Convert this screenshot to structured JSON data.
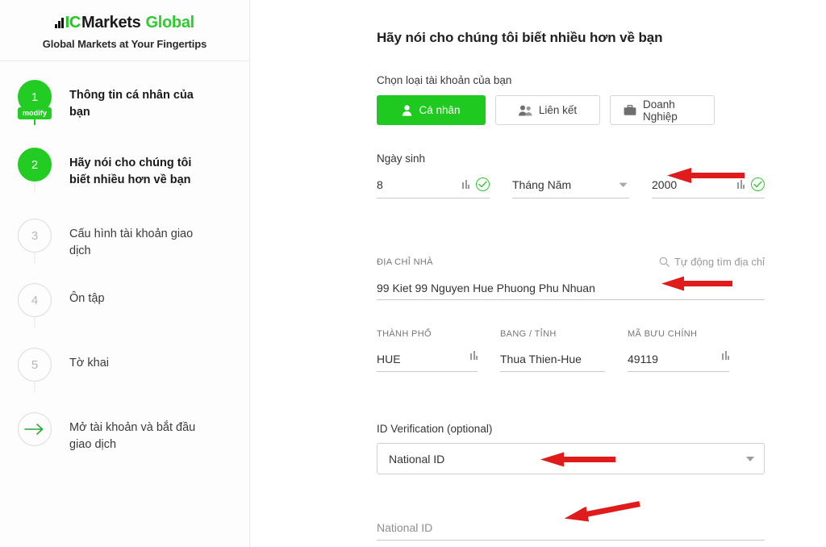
{
  "sidebar": {
    "brand": {
      "logo_icon": "bar-chart-icon",
      "part_ic": "IC",
      "part_markets": "Markets",
      "part_global": "Global",
      "tagline": "Global Markets at Your Fingertips",
      "color_green": "#1fc91f",
      "color_black": "#1a1a1a"
    },
    "steps": [
      {
        "number": "1",
        "label": "Thông tin cá nhân của bạn",
        "state": "done",
        "badge": "modify"
      },
      {
        "number": "2",
        "label": "Hãy nói cho chúng tôi biết nhiều hơn về bạn",
        "state": "active"
      },
      {
        "number": "3",
        "label": "Cấu hình tài khoản giao dịch",
        "state": "todo"
      },
      {
        "number": "4",
        "label": "Ôn tập",
        "state": "todo"
      },
      {
        "number": "5",
        "label": "Tờ khai",
        "state": "todo"
      },
      {
        "number": "",
        "label": "Mở tài khoản và bắt đầu giao dịch",
        "state": "arrow",
        "icon": "arrow-right-icon"
      }
    ]
  },
  "main": {
    "title": "Hãy nói cho chúng tôi biết nhiều hơn về bạn",
    "account_type": {
      "label": "Chọn loại tài khoản của bạn",
      "options": [
        {
          "label": "Cá nhân",
          "icon": "person-icon",
          "selected": true
        },
        {
          "label": "Liên kết",
          "icon": "people-icon",
          "selected": false
        },
        {
          "label": "Doanh Nghiệp",
          "icon": "briefcase-icon",
          "selected": false
        }
      ],
      "active_color": "#1fc91f"
    },
    "dob": {
      "label": "Ngày sinh",
      "day": "8",
      "month": "Tháng Năm",
      "year": "2000",
      "day_valid_icon": "check-circle-icon",
      "year_valid_icon": "check-circle-icon",
      "month_caret_icon": "chevron-down-icon"
    },
    "address": {
      "label": "ĐỊA CHỈ NHÀ",
      "autofind_label": "Tự động tìm địa chỉ",
      "autofind_icon": "search-icon",
      "value": "99 Kiet 99 Nguyen Hue Phuong Phu Nhuan"
    },
    "locality": [
      {
        "label": "THÀNH PHỐ",
        "value": "HUE"
      },
      {
        "label": "BANG / TỈNH",
        "value": "Thua Thien-Hue"
      },
      {
        "label": "MÃ BƯU CHÍNH",
        "value": "49119"
      }
    ],
    "id_verification": {
      "label": "ID Verification (optional)",
      "selected": "National ID",
      "caret_icon": "chevron-down-icon",
      "national_id_placeholder": "National ID"
    },
    "annotations": {
      "color": "#e01b1b",
      "arrow_icon": "arrow-left-annotation"
    }
  }
}
